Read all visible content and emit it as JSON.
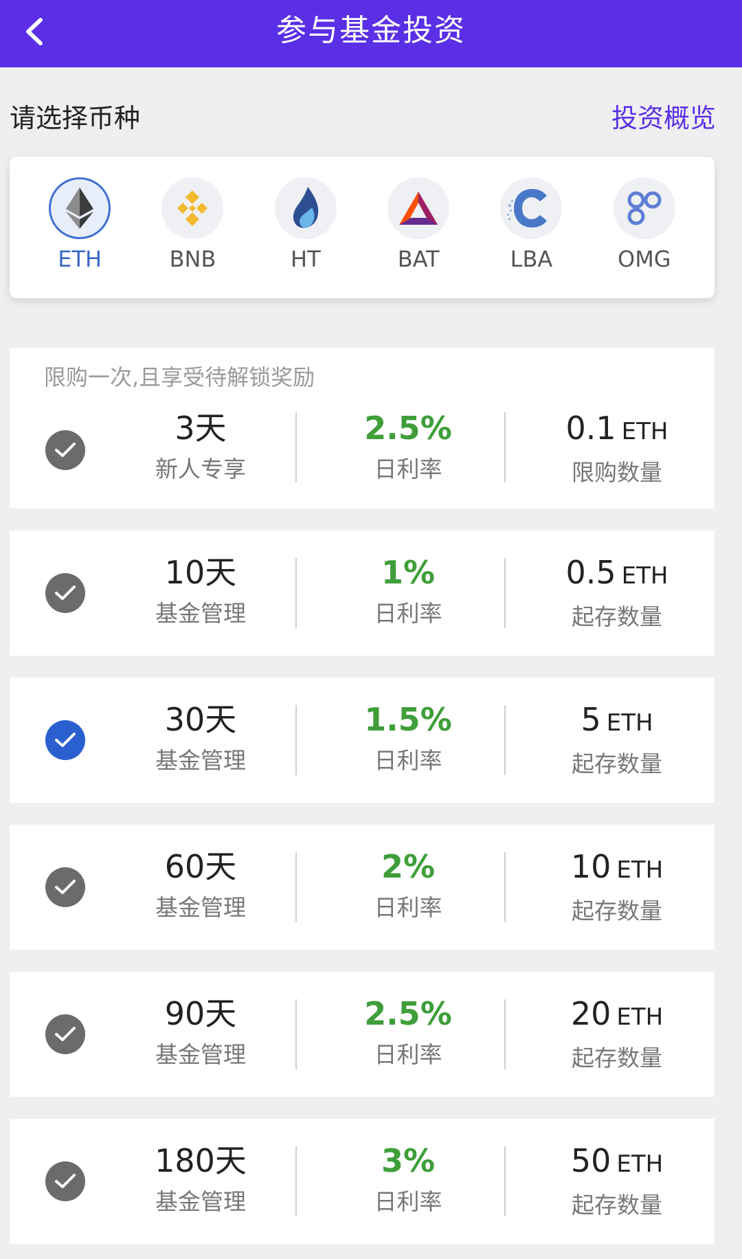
{
  "header": {
    "title": "参与基金投资"
  },
  "section": {
    "title": "请选择币种",
    "overview_link": "投资概览"
  },
  "coins": [
    {
      "label": "ETH",
      "icon": "eth-icon",
      "selected": true
    },
    {
      "label": "BNB",
      "icon": "bnb-icon",
      "selected": false
    },
    {
      "label": "HT",
      "icon": "ht-flame-icon",
      "selected": false
    },
    {
      "label": "BAT",
      "icon": "bat-triangle-icon",
      "selected": false
    },
    {
      "label": "LBA",
      "icon": "lba-icon",
      "selected": false
    },
    {
      "label": "OMG",
      "icon": "omg-icon",
      "selected": false
    }
  ],
  "plans": [
    {
      "note": "限购一次,且享受待解锁奖励",
      "days": "3天",
      "type": "新人专享",
      "rate": "2.5%",
      "rate_label": "日利率",
      "amount": "0.1",
      "unit": "ETH",
      "amount_label": "限购数量",
      "checked": false
    },
    {
      "days": "10天",
      "type": "基金管理",
      "rate": "1%",
      "rate_label": "日利率",
      "amount": "0.5",
      "unit": "ETH",
      "amount_label": "起存数量",
      "checked": false
    },
    {
      "days": "30天",
      "type": "基金管理",
      "rate": "1.5%",
      "rate_label": "日利率",
      "amount": "5",
      "unit": "ETH",
      "amount_label": "起存数量",
      "checked": true
    },
    {
      "days": "60天",
      "type": "基金管理",
      "rate": "2%",
      "rate_label": "日利率",
      "amount": "10",
      "unit": "ETH",
      "amount_label": "起存数量",
      "checked": false
    },
    {
      "days": "90天",
      "type": "基金管理",
      "rate": "2.5%",
      "rate_label": "日利率",
      "amount": "20",
      "unit": "ETH",
      "amount_label": "起存数量",
      "checked": false
    },
    {
      "days": "180天",
      "type": "基金管理",
      "rate": "3%",
      "rate_label": "日利率",
      "amount": "50",
      "unit": "ETH",
      "amount_label": "起存数量",
      "checked": false
    }
  ],
  "colors": {
    "brand": "#5a2fe6",
    "rate_green": "#3f9e3a",
    "check_selected": "#2a5fd0",
    "check_default": "#6b6b6b"
  }
}
